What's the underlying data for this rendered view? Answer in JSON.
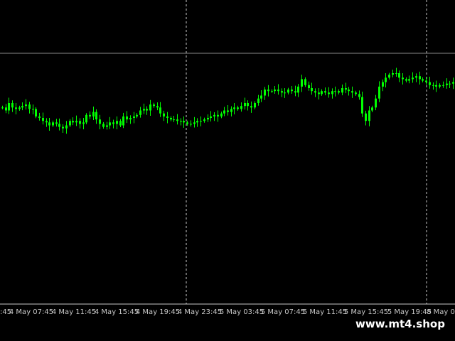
{
  "watermark": "www.mt4.shop",
  "colors": {
    "background": "#000000",
    "candle": "#00ff00",
    "grid": "#c8c8c8",
    "hline": "#8a8a8a",
    "axis_text": "#c8c8c8"
  },
  "chart_data": {
    "type": "candlestick",
    "title": "",
    "xlabel": "",
    "ylabel": "",
    "grid": false,
    "x_tick_labels": [
      "4 May 07:45",
      "4 May 11:45",
      "4 May 15:45",
      "4 May 19:45",
      "4 May 23:45",
      "5 May 03:45",
      "5 May 07:45",
      "5 May 11:45",
      "5 May 15:45",
      "5 May 19:45",
      "8 May 0"
    ],
    "x_tick_left_cut": ":45",
    "session_separators": [
      "4 May 23:45",
      "8 May 0"
    ],
    "horizontal_line_level": 64,
    "ylim": [
      0,
      100
    ],
    "series": [
      {
        "values": [
          47,
          45,
          50,
          47,
          46,
          47,
          48,
          49,
          46,
          46,
          41,
          40,
          38,
          37,
          35,
          37,
          36,
          34,
          33,
          35,
          38,
          37,
          38,
          36,
          37,
          42,
          41,
          44,
          39,
          36,
          34,
          35,
          37,
          36,
          38,
          35,
          41,
          39,
          40,
          41,
          42,
          45,
          46,
          45,
          49,
          48,
          47,
          43,
          41,
          40,
          39,
          39,
          38,
          38,
          37,
          36,
          36,
          37,
          38,
          38,
          39,
          40,
          41,
          42,
          41,
          43,
          45,
          44,
          46,
          47,
          46,
          48,
          50,
          48,
          47,
          50,
          53,
          55,
          59,
          58,
          58,
          59,
          58,
          57,
          57,
          59,
          58,
          57,
          61,
          66,
          62,
          60,
          58,
          57,
          56,
          58,
          57,
          56,
          58,
          58,
          57,
          60,
          59,
          58,
          57,
          56,
          54,
          43,
          38,
          45,
          47,
          53,
          61,
          64,
          67,
          69,
          70,
          70,
          67,
          66,
          65,
          66,
          67,
          68,
          66,
          65,
          64,
          62,
          62,
          61,
          62,
          62,
          63,
          63,
          64
        ]
      }
    ]
  }
}
